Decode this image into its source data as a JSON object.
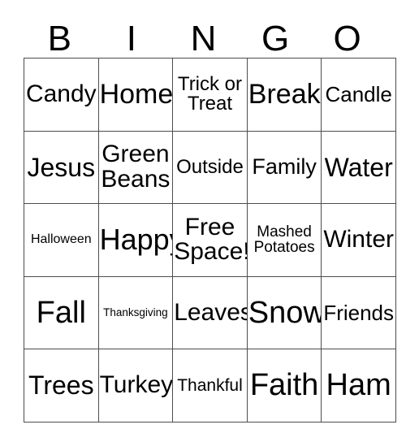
{
  "card": {
    "header_letters": [
      "B",
      "I",
      "N",
      "G",
      "O"
    ],
    "rows": [
      [
        {
          "text": "Candy",
          "size": "s-4xl"
        },
        {
          "text": "Home",
          "size": "s-6xl"
        },
        {
          "text": "Trick or\nTreat",
          "size": "s-xl"
        },
        {
          "text": "Break",
          "size": "s-6xl"
        },
        {
          "text": "Candle",
          "size": "s-2xl"
        }
      ],
      [
        {
          "text": "Jesus",
          "size": "s-5xl"
        },
        {
          "text": "Green\nBeans",
          "size": "s-4xl"
        },
        {
          "text": "Outside",
          "size": "s-xl"
        },
        {
          "text": "Family",
          "size": "s-3xl"
        },
        {
          "text": "Water",
          "size": "s-5xl"
        }
      ],
      [
        {
          "text": "Halloween",
          "size": "s-sm"
        },
        {
          "text": "Happy",
          "size": "s-7xl"
        },
        {
          "text": "Free\nSpace!",
          "size": "s-4xl"
        },
        {
          "text": "Mashed\nPotatoes",
          "size": "s-md"
        },
        {
          "text": "Winter",
          "size": "s-4xl"
        }
      ],
      [
        {
          "text": "Fall",
          "size": "s-8xl"
        },
        {
          "text": "Thanksgiving",
          "size": "s-xs"
        },
        {
          "text": "Leaves",
          "size": "s-4xl"
        },
        {
          "text": "Snow",
          "size": "s-8xl"
        },
        {
          "text": "Friends",
          "size": "s-2xl"
        }
      ],
      [
        {
          "text": "Trees",
          "size": "s-5xl"
        },
        {
          "text": "Turkey",
          "size": "s-4xl"
        },
        {
          "text": "Thankful",
          "size": "s-lg"
        },
        {
          "text": "Faith",
          "size": "s-8xl"
        },
        {
          "text": "Ham",
          "size": "s-8xl"
        }
      ]
    ]
  }
}
